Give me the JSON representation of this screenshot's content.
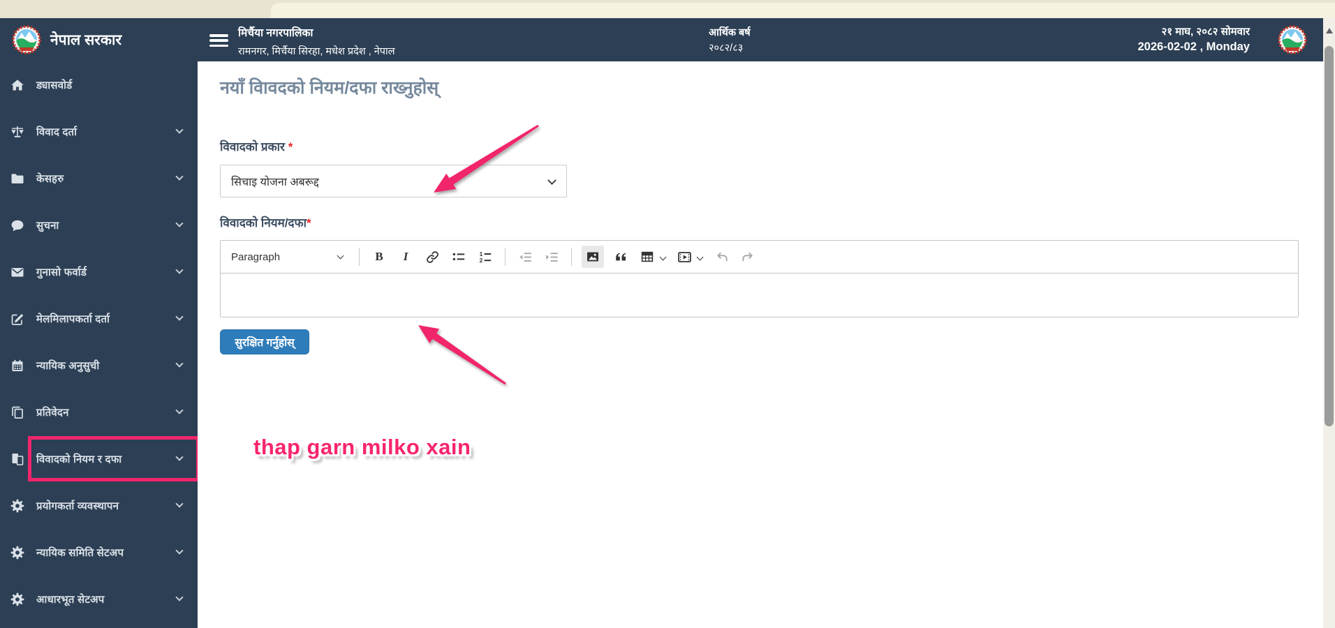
{
  "navbar": {
    "brand": "नेपाल सरकार",
    "municipality": "मिर्चैया नगरपालिका",
    "address": "रामनगर, मिर्चैया सिरहा, मधेश प्रदेश , नेपाल",
    "fiscal_year_label": "आर्थिक बर्ष",
    "fiscal_year_value": "२०८२/८३",
    "date_np": "२१ माघ, २०८२ सोमवार",
    "date_en": "2026-02-02 , Monday"
  },
  "sidebar": {
    "items": [
      {
        "label": "ड्यासवोर्ड",
        "icon": "home-icon",
        "has_submenu": false,
        "highlighted": false
      },
      {
        "label": "विवाद दर्ता",
        "icon": "scale-icon",
        "has_submenu": true,
        "highlighted": false
      },
      {
        "label": "केसहरु",
        "icon": "folder-icon",
        "has_submenu": true,
        "highlighted": false
      },
      {
        "label": "सुचना",
        "icon": "comment-icon",
        "has_submenu": true,
        "highlighted": false
      },
      {
        "label": "गुनासो फर्वार्ड",
        "icon": "envelope-icon",
        "has_submenu": true,
        "highlighted": false
      },
      {
        "label": "मेलमिलापकर्ता दर्ता",
        "icon": "edit-icon",
        "has_submenu": true,
        "highlighted": false
      },
      {
        "label": "न्यायिक अनुसुची",
        "icon": "calendar-icon",
        "has_submenu": true,
        "highlighted": false
      },
      {
        "label": "प्रतिवेदन",
        "icon": "report-icon",
        "has_submenu": true,
        "highlighted": false
      },
      {
        "label": "विवादको नियम र दफा",
        "icon": "file-icon",
        "has_submenu": true,
        "highlighted": true
      },
      {
        "label": "प्रयोगकर्ता व्यवस्थापन",
        "icon": "gear-icon",
        "has_submenu": true,
        "highlighted": false
      },
      {
        "label": "न्यायिक समिति सेटअप",
        "icon": "gear-icon",
        "has_submenu": true,
        "highlighted": false
      },
      {
        "label": "आधारभूत सेटअप",
        "icon": "gear-icon",
        "has_submenu": true,
        "highlighted": false
      }
    ]
  },
  "main": {
    "title": "नयाँ विावदको नियम/दफा राख्नुहोस्",
    "form": {
      "type_label": "विवादको प्रकार",
      "required_mark": "*",
      "type_value": "सिचाइ योजना अबरूद्द",
      "rule_label": "विवादको नियम/दफा",
      "save_label": "सुरक्षित गर्नुहोस्"
    },
    "editor": {
      "paragraph_label": "Paragraph",
      "toolbar_buttons": [
        "paragraph-style",
        "bold",
        "italic",
        "link",
        "bulleted-list",
        "numbered-list",
        "outdent",
        "indent",
        "insert-image",
        "block-quote",
        "insert-table",
        "insert-media",
        "undo",
        "redo"
      ],
      "active_button": "insert-image",
      "disabled_buttons": [
        "outdent",
        "indent",
        "undo",
        "redo"
      ]
    },
    "annotation": {
      "text": "thap garn milko xain"
    }
  },
  "colors": {
    "navy": "#2c3f54",
    "annotation_pink": "#f1256b",
    "button_blue": "#2e7cba",
    "title_gray_blue": "#75889c",
    "required_red": "#e8252a"
  }
}
